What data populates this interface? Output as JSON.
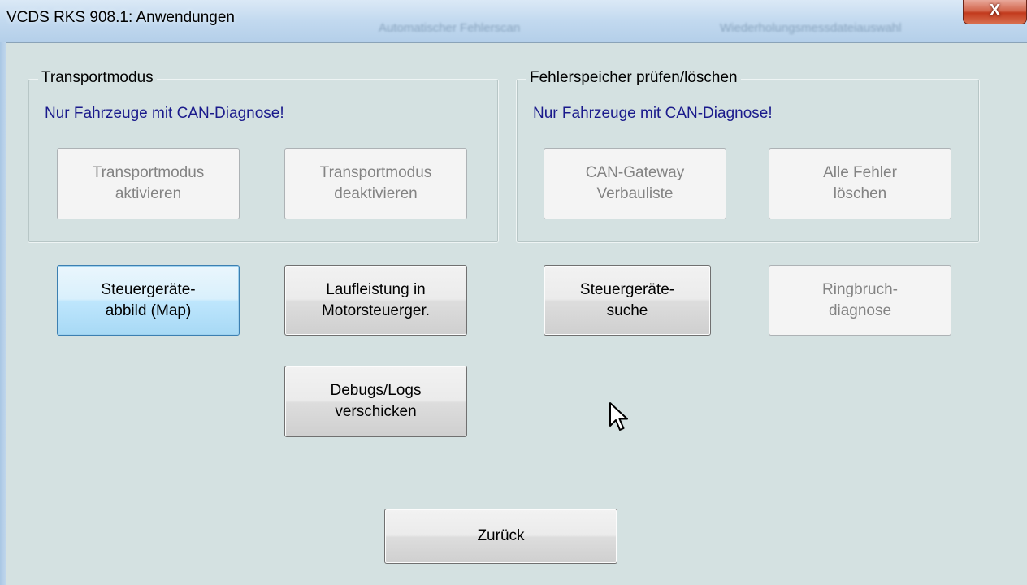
{
  "window": {
    "title": "VCDS RKS 908.1:  Anwendungen",
    "background_titles": [
      "Automatischer Fehlerscan",
      "Wiederholungsmessdateiauswahl"
    ],
    "close_glyph": "X"
  },
  "groups": {
    "transport": {
      "label": "Transportmodus",
      "note": "Nur Fahrzeuge mit CAN-Diagnose!",
      "buttons": [
        {
          "line1": "Transportmodus",
          "line2": "aktivieren",
          "state": "disabled"
        },
        {
          "line1": "Transportmodus",
          "line2": "deaktivieren",
          "state": "disabled"
        }
      ]
    },
    "fehlerspeicher": {
      "label": "Fehlerspeicher prüfen/löschen",
      "note": "Nur Fahrzeuge mit CAN-Diagnose!",
      "buttons": [
        {
          "line1": "CAN-Gateway",
          "line2": "Verbauliste",
          "state": "disabled"
        },
        {
          "line1": "Alle Fehler",
          "line2": "löschen",
          "state": "disabled"
        }
      ]
    }
  },
  "actions": [
    {
      "line1": "Steuergeräte-",
      "line2": "abbild (Map)",
      "state": "focused"
    },
    {
      "line1": "Laufleistung in",
      "line2": "Motorsteuerger.",
      "state": "enabled"
    },
    {
      "line1": "Steuergeräte-",
      "line2": "suche",
      "state": "enabled"
    },
    {
      "line1": "Ringbruch-",
      "line2": "diagnose",
      "state": "disabled"
    },
    {
      "line1": "Debugs/Logs",
      "line2": "verschicken",
      "state": "enabled"
    }
  ],
  "back_button": {
    "label": "Zurück"
  },
  "cursor_icon": "mouse-pointer-icon",
  "colors": {
    "note_text": "#1a1a8c",
    "dialog_bg": "#d4e1e1",
    "disabled_text": "#838383",
    "focus_border": "#3c7fb1"
  }
}
